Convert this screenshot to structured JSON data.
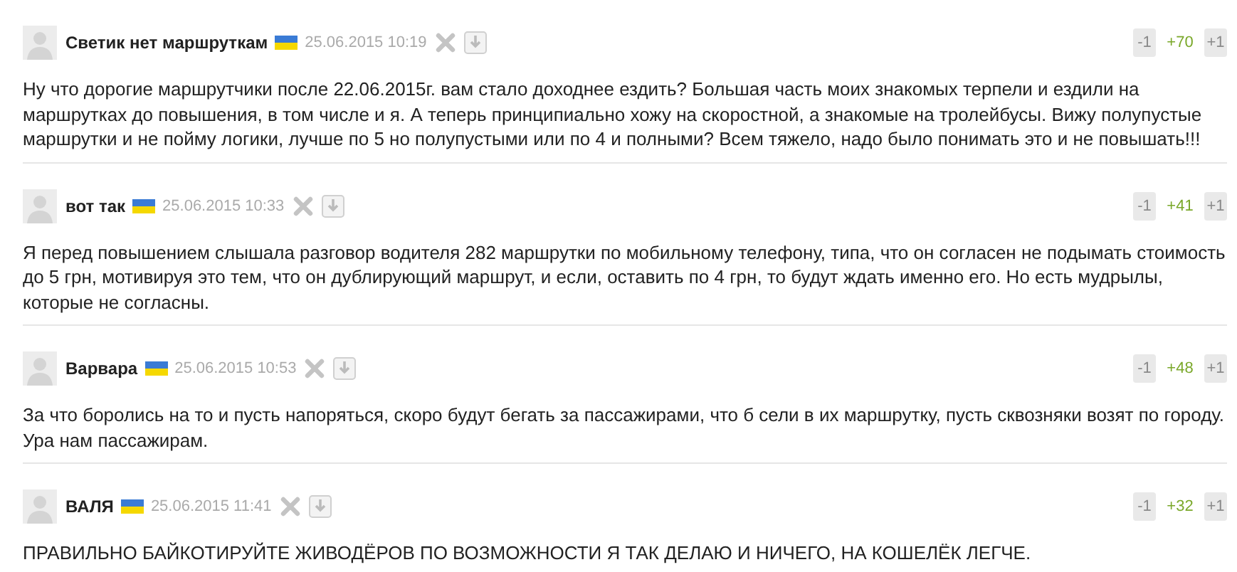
{
  "comments": [
    {
      "author": "Светик нет маршруткам",
      "date": "25.06.2015 10:19",
      "minus": "-1",
      "score": "+70",
      "plus": "+1",
      "text": "Ну что дорогие маршрутчики после 22.06.2015г. вам стало доходнее ездить? Большая часть моих знакомых терпели и ездили на маршрутках до повышения, в том числе и я. А теперь принципиально хожу на скоростной, а знакомые на тролейбусы. Вижу полупустые маршрутки и не пойму логики, лучше по 5 но полупустыми или по 4 и полными? Всем тяжело, надо было понимать это и не повышать!!!"
    },
    {
      "author": "вот так",
      "date": "25.06.2015 10:33",
      "minus": "-1",
      "score": "+41",
      "plus": "+1",
      "text": "Я перед повышением слышала разговор водителя 282 маршрутки по мобильному телефону, типа, что он согласен не подымать стоимость до 5 грн, мотивируя это тем, что он дублирующий маршрут, и если, оставить по 4 грн, то будут ждать именно его. Но есть мудрылы, которые не согласны."
    },
    {
      "author": "Варвара",
      "date": "25.06.2015 10:53",
      "minus": "-1",
      "score": "+48",
      "plus": "+1",
      "text": "За что боролись на то и пусть напоряться, скоро будут бегать за пассажирами, что б сели в их маршрутку, пусть сквозняки возят по городу. Ура нам пассажирам."
    },
    {
      "author": "ВАЛЯ",
      "date": "25.06.2015 11:41",
      "minus": "-1",
      "score": "+32",
      "plus": "+1",
      "text": "ПРАВИЛЬНО БАЙКОТИРУЙТЕ ЖИВОДЁРОВ ПО ВОЗМОЖНОСТИ Я ТАК ДЕЛАЮ И НИЧЕГО, НА КОШЕЛЁК ЛЕГЧЕ."
    }
  ]
}
